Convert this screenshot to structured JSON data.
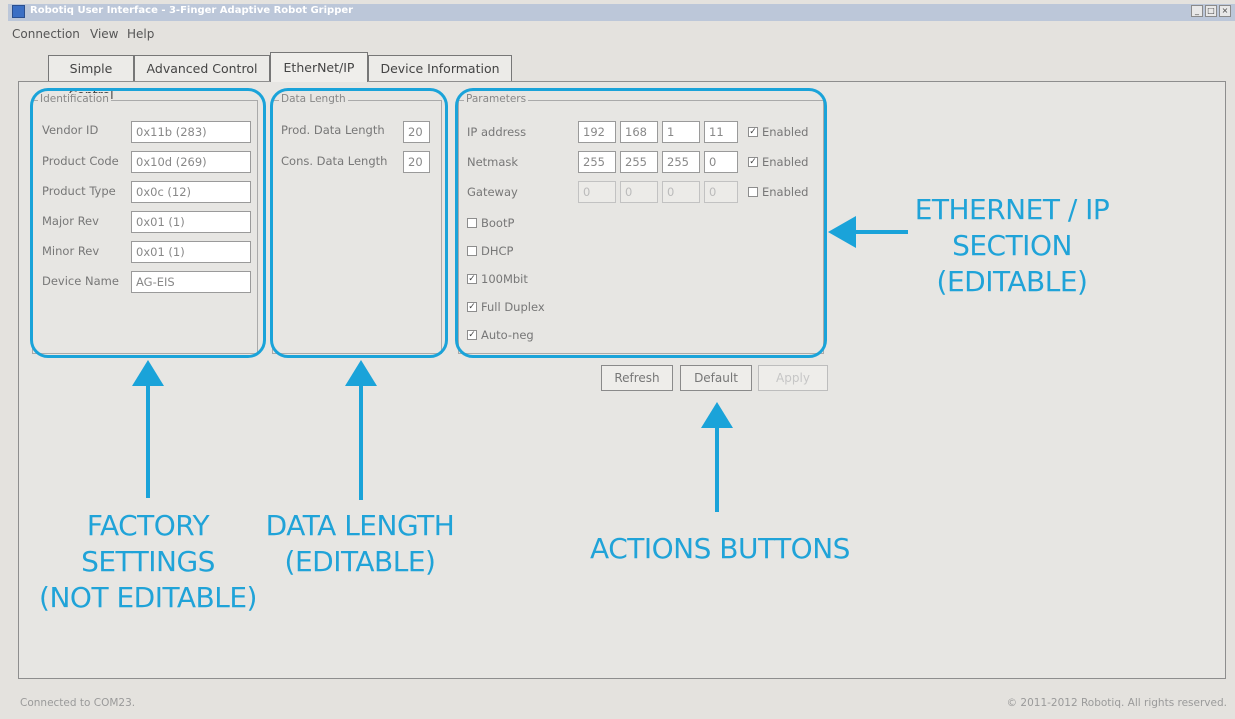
{
  "window": {
    "title": "Robotiq User Interface - 3-Finger Adaptive Robot Gripper",
    "controls": {
      "minimize": "_",
      "maximize": "□",
      "close": "×"
    }
  },
  "menu": [
    "Connection",
    "View",
    "Help"
  ],
  "tabs": [
    "Simple Control",
    "Advanced Control",
    "EtherNet/IP",
    "Device Information"
  ],
  "identification": {
    "title": "Identification",
    "fields": [
      {
        "label": "Vendor ID",
        "value": "0x11b (283)"
      },
      {
        "label": "Product Code",
        "value": "0x10d (269)"
      },
      {
        "label": "Product Type",
        "value": "0x0c (12)"
      },
      {
        "label": "Major Rev",
        "value": "0x01 (1)"
      },
      {
        "label": "Minor Rev",
        "value": "0x01 (1)"
      },
      {
        "label": "Device Name",
        "value": "AG-EIS"
      }
    ]
  },
  "data_length": {
    "title": "Data Length",
    "fields": [
      {
        "label": "Prod. Data Length",
        "value": "20"
      },
      {
        "label": "Cons. Data Length",
        "value": "20"
      }
    ]
  },
  "parameters": {
    "title": "Parameters",
    "rows": [
      {
        "label": "IP address",
        "octets": [
          "192",
          "168",
          "1",
          "11"
        ],
        "enabled_label": "Enabled",
        "checked": true,
        "disabled": false
      },
      {
        "label": "Netmask",
        "octets": [
          "255",
          "255",
          "255",
          "0"
        ],
        "enabled_label": "Enabled",
        "checked": true,
        "disabled": false
      },
      {
        "label": "Gateway",
        "octets": [
          "0",
          "0",
          "0",
          "0"
        ],
        "enabled_label": "Enabled",
        "checked": false,
        "disabled": true
      }
    ],
    "options": [
      {
        "label": "BootP",
        "checked": false
      },
      {
        "label": "DHCP",
        "checked": false
      },
      {
        "label": "100Mbit",
        "checked": true
      },
      {
        "label": "Full Duplex",
        "checked": true
      },
      {
        "label": "Auto-neg",
        "checked": true
      }
    ]
  },
  "actions": {
    "refresh": "Refresh",
    "default": "Default",
    "apply": "Apply"
  },
  "annotations": {
    "ethernet": [
      "ETHERNET / IP",
      "SECTION",
      "(EDITABLE)"
    ],
    "factory": [
      "FACTORY",
      "SETTINGS",
      "(NOT EDITABLE)"
    ],
    "data_length": [
      "DATA LENGTH",
      "(EDITABLE)"
    ],
    "actions": [
      "ACTIONS BUTTONS"
    ]
  },
  "status": {
    "left": "Connected to COM23.",
    "right": "© 2011-2012 Robotiq. All rights reserved."
  },
  "colors": {
    "annotation": "#1aa3d9",
    "titlebar": "#bcc7d9"
  }
}
